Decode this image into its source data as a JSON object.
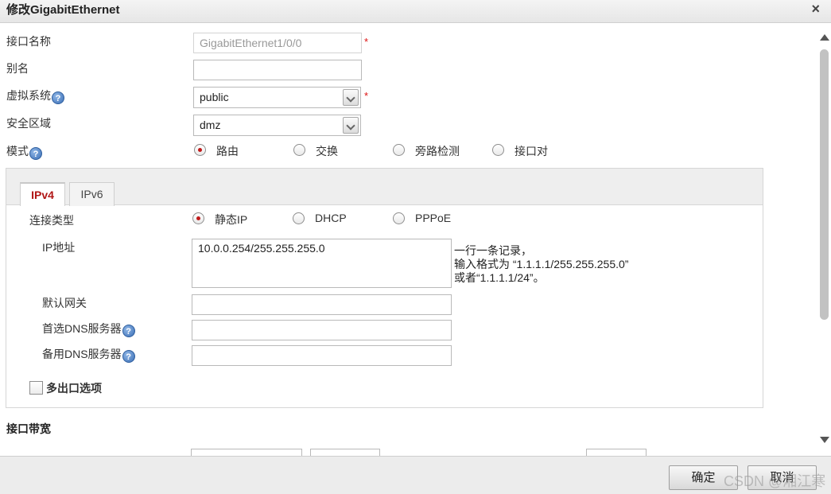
{
  "window": {
    "title": "修改GigabitEthernet",
    "close_glyph": "×"
  },
  "form": {
    "interface_name_label": "接口名称",
    "interface_name_value": "GigabitEthernet1/0/0",
    "alias_label": "别名",
    "alias_value": "",
    "vsys_label": "虚拟系统",
    "vsys_value": "public",
    "zone_label": "安全区域",
    "zone_value": "dmz",
    "mode_label": "模式",
    "mode_options": [
      "路由",
      "交换",
      "旁路检测",
      "接口对"
    ],
    "mode_selected": "路由",
    "required_mark": "*",
    "help_glyph": "?"
  },
  "tabs": [
    {
      "label": "IPv4",
      "active": true
    },
    {
      "label": "IPv6",
      "active": false
    }
  ],
  "ipv4": {
    "conn_type_label": "连接类型",
    "conn_type_options": [
      "静态IP",
      "DHCP",
      "PPPoE"
    ],
    "conn_type_selected": "静态IP",
    "ip_label": "IP地址",
    "ip_value": "10.0.0.254/255.255.255.0",
    "ip_hint_lines": [
      "一行一条记录，",
      "输入格式为 “1.1.1.1/255.255.255.0”",
      "或者“1.1.1.1/24”。"
    ],
    "gateway_label": "默认网关",
    "gateway_value": "",
    "dns1_label": "首选DNS服务器",
    "dns1_value": "",
    "dns2_label": "备用DNS服务器",
    "dns2_value": "",
    "multi_egress_label": "多出口选项"
  },
  "bandwidth": {
    "section_title": "接口带宽"
  },
  "footer": {
    "ok_label": "确定",
    "cancel_label": "取消"
  },
  "watermark": "CSDN @湘江寒",
  "colors": {
    "accent": "#b01515",
    "radio_dot": "#c01a1a",
    "required": "#dd1111"
  }
}
